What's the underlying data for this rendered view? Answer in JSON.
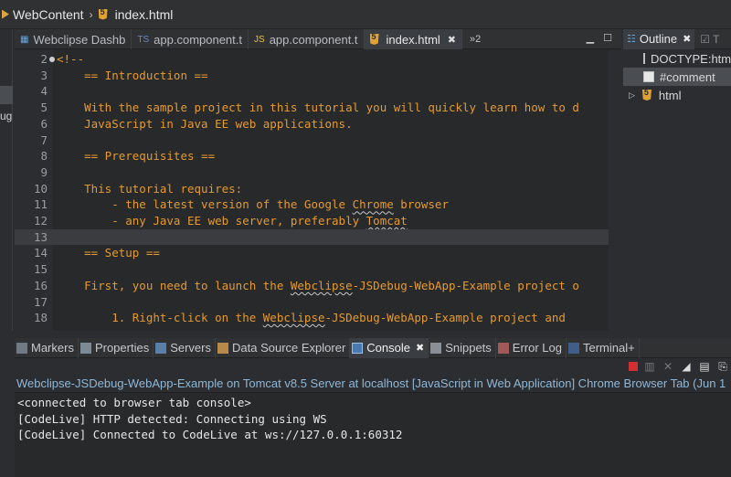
{
  "breadcrumb": {
    "project": "WebContent",
    "file": "index.html"
  },
  "left_strip": {
    "text": "ug"
  },
  "editor_tabs": [
    {
      "label": "Webclipse Dashb",
      "icon": "webclipse-icon",
      "active": false
    },
    {
      "label": "app.component.t",
      "icon": "typescript-icon",
      "prefix": "TS",
      "active": false
    },
    {
      "label": "app.component.t",
      "icon": "javascript-icon",
      "prefix": "JS",
      "active": false
    },
    {
      "label": "index.html",
      "icon": "html5-icon",
      "active": true
    }
  ],
  "editor_tabs_overflow": "»2",
  "editor": {
    "lines": [
      {
        "num": "2",
        "text": "<!--"
      },
      {
        "num": "3",
        "text": "    == Introduction =="
      },
      {
        "num": "4",
        "text": ""
      },
      {
        "num": "5",
        "text": "    With the sample project in this tutorial you will quickly learn how to d"
      },
      {
        "num": "6",
        "text": "    JavaScript in Java EE web applications."
      },
      {
        "num": "7",
        "text": ""
      },
      {
        "num": "8",
        "text": "    == Prerequisites =="
      },
      {
        "num": "9",
        "text": ""
      },
      {
        "num": "10",
        "text": "    This tutorial requires:"
      },
      {
        "num": "11",
        "pre": "        - the latest version of the Google ",
        "squiggle": "Chrome",
        "post": " browser"
      },
      {
        "num": "12",
        "pre": "        - any Java EE web server, preferably ",
        "squiggle": "Tomcat",
        "post": ""
      },
      {
        "num": "13",
        "text": "",
        "current": true
      },
      {
        "num": "14",
        "text": "    == Setup =="
      },
      {
        "num": "15",
        "text": ""
      },
      {
        "num": "16",
        "pre": "    First, you need to launch the ",
        "squiggle": "Webclipse",
        "post": "-JSDebug-WebApp-Example project o"
      },
      {
        "num": "17",
        "text": ""
      },
      {
        "num": "18",
        "pre": "        1. Right-click on the ",
        "squiggle": "Webclipse",
        "post": "-JSDebug-WebApp-Example project and"
      }
    ]
  },
  "outline": {
    "tab_label": "Outline",
    "items": [
      {
        "label": "DOCTYPE:htm",
        "icon": "doctype-icon",
        "selected": false
      },
      {
        "label": "#comment",
        "icon": "comment-icon",
        "selected": true
      },
      {
        "label": "html",
        "icon": "html5-icon",
        "selected": false,
        "expandable": true
      }
    ]
  },
  "bottom_tabs": [
    {
      "label": "Markers",
      "icon": "markers-icon",
      "active": false
    },
    {
      "label": "Properties",
      "icon": "properties-icon",
      "active": false
    },
    {
      "label": "Servers",
      "icon": "servers-icon",
      "active": false
    },
    {
      "label": "Data Source Explorer",
      "icon": "datasource-icon",
      "active": false
    },
    {
      "label": "Console",
      "icon": "console-icon",
      "active": true
    },
    {
      "label": "Snippets",
      "icon": "snippets-icon",
      "active": false
    },
    {
      "label": "Error Log",
      "icon": "error-log-icon",
      "active": false
    },
    {
      "label": "Terminal+",
      "icon": "terminal-icon",
      "active": false
    }
  ],
  "console": {
    "description": "Webclipse-JSDebug-WebApp-Example on Tomcat v8.5 Server at localhost [JavaScript in Web Application] Chrome Browser Tab (Jun 1",
    "lines": [
      "<connected to browser tab console>",
      "[CodeLive] HTTP detected: Connecting using WS",
      "[CodeLive] Connected to CodeLive at ws://127.0.0.1:60312"
    ]
  },
  "colors": {
    "code": "#e49a32",
    "console_desc": "#8fb8d8",
    "editor_bg": "#28292b",
    "panel_bg": "#2b2d30"
  }
}
